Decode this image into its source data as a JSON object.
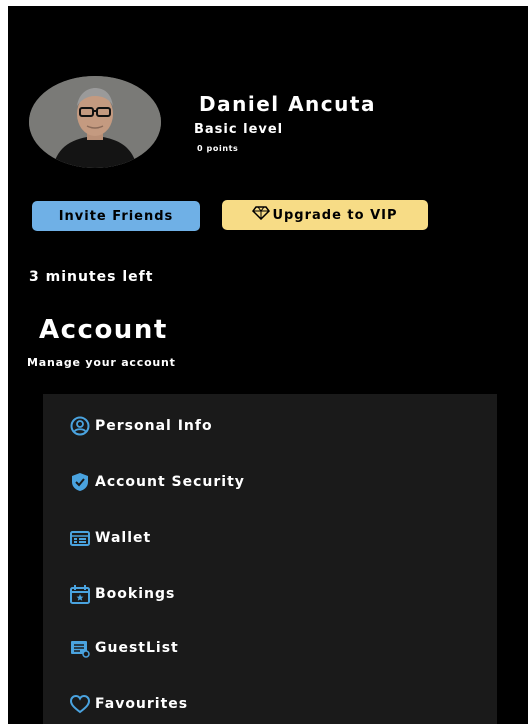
{
  "profile": {
    "name": "Daniel Ancuta",
    "level": "Basic level",
    "points": "0 points"
  },
  "actions": {
    "invite_label": "Invite Friends",
    "upgrade_label": "Upgrade to VIP",
    "upgrade_icon": "diamond-icon"
  },
  "status": {
    "time_left": "3 minutes left"
  },
  "account": {
    "title": "Account",
    "subtitle": "Manage your account"
  },
  "menu": {
    "items": [
      {
        "label": "Personal Info",
        "icon": "user-circle-icon"
      },
      {
        "label": "Account Security",
        "icon": "shield-check-icon"
      },
      {
        "label": "Wallet",
        "icon": "wallet-icon"
      },
      {
        "label": "Bookings",
        "icon": "calendar-icon"
      },
      {
        "label": "GuestList",
        "icon": "guest-list-icon"
      },
      {
        "label": "Favourites",
        "icon": "heart-icon"
      }
    ]
  },
  "colors": {
    "background": "#000000",
    "menu_panel": "#1a1a1a",
    "invite_button": "#6fb0e6",
    "vip_button": "#f7dc86",
    "icon_accent": "#4aa3df"
  }
}
